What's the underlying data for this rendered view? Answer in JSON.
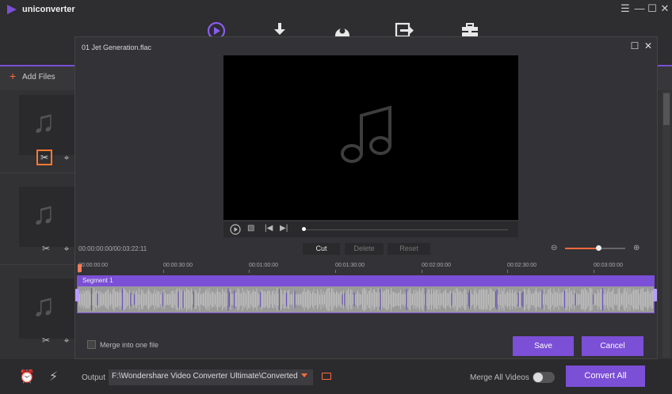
{
  "app": {
    "title": "uniconverter",
    "window_controls": [
      "menu-icon",
      "minimize-icon",
      "maximize-icon",
      "close-icon"
    ]
  },
  "nav": {
    "icons": [
      "convert-icon",
      "download-icon",
      "record-icon",
      "transfer-icon",
      "toolbox-icon"
    ],
    "active": "convert-icon",
    "accent_color": "#7b4fd6"
  },
  "toolbar": {
    "add_files_label": "Add Files"
  },
  "file_list": {
    "items": [
      {
        "icon": "music-note-icon",
        "tools": [
          "scissors-icon",
          "crop-icon"
        ],
        "active_tool": "scissors-icon"
      },
      {
        "icon": "music-note-icon",
        "tools": [
          "scissors-icon",
          "crop-icon"
        ]
      },
      {
        "icon": "music-note-icon",
        "tools": [
          "scissors-icon",
          "crop-icon"
        ]
      }
    ]
  },
  "dialog": {
    "title": "01 Jet Generation.flac",
    "controls": [
      "maximize-icon",
      "close-icon"
    ],
    "preview_icon": "music-note-icon",
    "player_controls": [
      "play-icon",
      "snapshot-icon",
      "previous-icon",
      "next-icon"
    ],
    "timecode": "00:00:00:00/00:03:22:11",
    "buttons": {
      "cut": "Cut",
      "delete": "Delete",
      "reset": "Reset"
    },
    "zoom": {
      "out_icon": "zoom-out-icon",
      "in_icon": "zoom-in-icon",
      "level": 0.55
    },
    "ruler_labels": [
      "00:00:00:00",
      "00:00:30:00",
      "00:01:00:00",
      "00:01:30:00",
      "00:02:00:00",
      "00:02:30:00",
      "00:03:00:00"
    ],
    "segment_label": "Segment 1",
    "merge_label": "Merge into one file",
    "save_label": "Save",
    "cancel_label": "Cancel"
  },
  "bottom": {
    "icons": [
      "alarm-icon",
      "lightning-icon"
    ],
    "output_label": "Output",
    "output_path": "F:\\Wondershare Video Converter Ultimate\\Converted",
    "merge_all_label": "Merge All Videos",
    "merge_all_on": false,
    "convert_all_label": "Convert All"
  }
}
